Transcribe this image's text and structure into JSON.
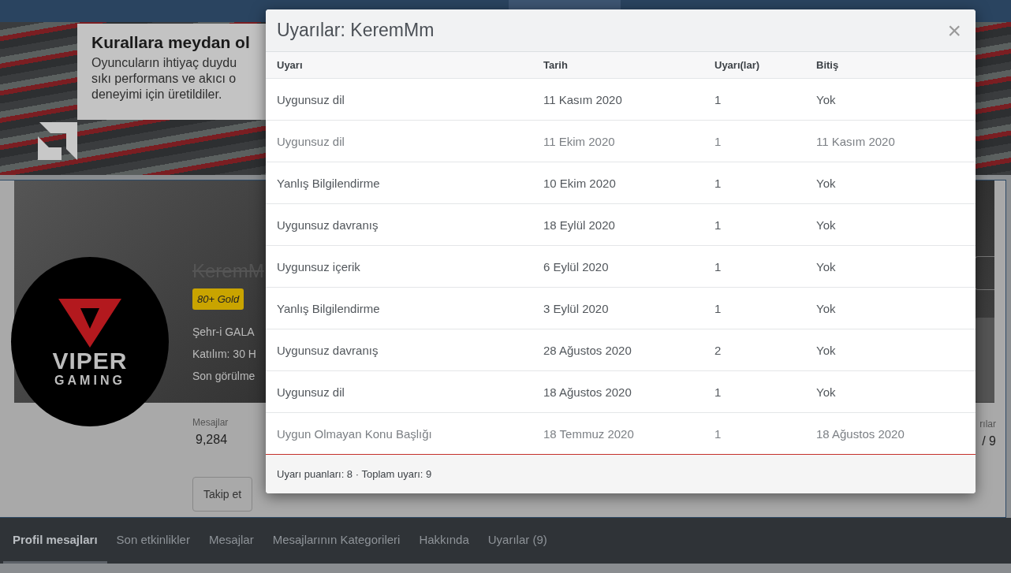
{
  "banner": {
    "headline": "Kurallara meydan ol",
    "lines": [
      "Oyuncuların ihtiyaç duydu",
      "sıkı performans ve akıcı o",
      "deneyimi için üretildiler."
    ]
  },
  "profile": {
    "avatar_text": [
      "VIPER",
      "GAMING"
    ],
    "username": "KeremM",
    "banned": true,
    "badge": "80+ Gold",
    "info_lines": [
      "Şehr-i GALA",
      "Katılım: 30 H",
      "Son görülme"
    ],
    "stats": [
      {
        "label": "Mesajlar",
        "value": "9,284"
      },
      {
        "label": "rılar",
        "value": "/ 9"
      }
    ],
    "buttons": [
      "Takip et"
    ]
  },
  "tabs": [
    {
      "label": "Profil mesajları",
      "selected": true
    },
    {
      "label": "Son etkinlikler",
      "selected": false
    },
    {
      "label": "Mesajlar",
      "selected": false
    },
    {
      "label": "Mesajlarının Kategorileri",
      "selected": false
    },
    {
      "label": "Hakkında",
      "selected": false
    },
    {
      "label": "Uyarılar (9)",
      "selected": false
    }
  ],
  "modal": {
    "title": "Uyarılar: KeremMm",
    "close": "×",
    "columns": [
      "Uyarı",
      "Tarih",
      "Uyarı(lar)",
      "Bitiş"
    ],
    "rows": [
      {
        "warning": "Uygunsuz dil",
        "date": "11 Kasım 2020",
        "count": "1",
        "expires": "Yok",
        "expired": false
      },
      {
        "warning": "Uygunsuz dil",
        "date": "11 Ekim 2020",
        "count": "1",
        "expires": "11 Kasım 2020",
        "expired": true
      },
      {
        "warning": "Yanlış Bilgilendirme",
        "date": "10 Ekim 2020",
        "count": "1",
        "expires": "Yok",
        "expired": false
      },
      {
        "warning": "Uygunsuz davranış",
        "date": "18 Eylül 2020",
        "count": "1",
        "expires": "Yok",
        "expired": false
      },
      {
        "warning": "Uygunsuz içerik",
        "date": "6 Eylül 2020",
        "count": "1",
        "expires": "Yok",
        "expired": false
      },
      {
        "warning": "Yanlış Bilgilendirme",
        "date": "3 Eylül 2020",
        "count": "1",
        "expires": "Yok",
        "expired": false
      },
      {
        "warning": "Uygunsuz davranış",
        "date": "28 Ağustos 2020",
        "count": "2",
        "expires": "Yok",
        "expired": false
      },
      {
        "warning": "Uygunsuz dil",
        "date": "18 Ağustos 2020",
        "count": "1",
        "expires": "Yok",
        "expired": false
      },
      {
        "warning": "Uygun Olmayan Konu Başlığı",
        "date": "18 Temmuz 2020",
        "count": "1",
        "expires": "18 Ağustos 2020",
        "expired": true
      }
    ],
    "footer": "Uyarı puanları: 8 · Toplam uyarı: 9"
  }
}
